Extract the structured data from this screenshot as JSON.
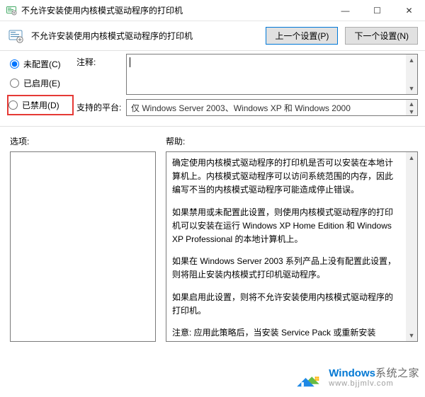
{
  "window": {
    "title": "不允许安装使用内核模式驱动程序的打印机",
    "minimize_glyph": "—",
    "maximize_glyph": "☐",
    "close_glyph": "✕"
  },
  "header": {
    "title": "不允许安装使用内核模式驱动程序的打印机",
    "prev_label": "上一个设置(P)",
    "next_label": "下一个设置(N)"
  },
  "radios": {
    "not_configured": {
      "label": "未配置(C)",
      "checked": true
    },
    "enabled": {
      "label": "已启用(E)",
      "checked": false
    },
    "disabled": {
      "label": "已禁用(D)",
      "checked": false
    }
  },
  "comment": {
    "label": "注释:",
    "value": ""
  },
  "platform": {
    "label": "支持的平台:",
    "value": "仅 Windows Server 2003、Windows XP 和 Windows 2000"
  },
  "options": {
    "label": "选项:"
  },
  "help": {
    "label": "帮助:",
    "p1": "确定使用内核模式驱动程序的打印机是否可以安装在本地计算机上。内核模式驱动程序可以访问系统范围的内存，因此编写不当的内核模式驱动程序可能造成停止错误。",
    "p2": "如果禁用或未配置此设置，则使用内核模式驱动程序的打印机可以安装在运行 Windows XP Home Edition 和 Windows XP Professional 的本地计算机上。",
    "p3": "如果在 Windows Server 2003 系列产品上没有配置此设置，则将阻止安装内核模式打印机驱动程序。",
    "p4": "如果启用此设置，则将不允许安装使用内核模式驱动程序的打印机。",
    "p5": "注意: 应用此策略后，当安装 Service Pack 或重新安装 Windows XP 操作系统时会禁用现有的内核模式驱动程序。此策略不适用于 64 位内核模式打印机驱动程序，因为这些驱动程序无法安装且不能与打印队列关联。"
  },
  "watermark": {
    "brand_en": "Windows",
    "brand_cn": "系统之家",
    "url": "www.bjjmlv.com"
  }
}
